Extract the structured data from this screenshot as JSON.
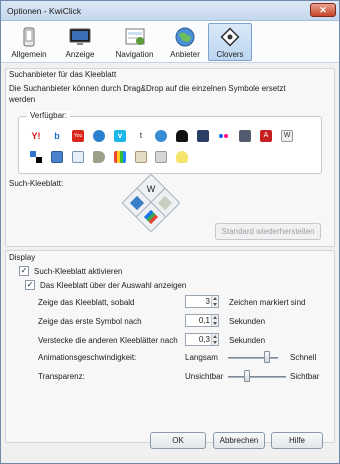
{
  "window": {
    "title": "Optionen - KwiClick",
    "close_label": "✕"
  },
  "toolbar": {
    "tabs": [
      {
        "label": "Allgemein",
        "icon": "device-icon"
      },
      {
        "label": "Anzeige",
        "icon": "monitor-icon"
      },
      {
        "label": "Navigation",
        "icon": "navigation-icon"
      },
      {
        "label": "Anbieter",
        "icon": "globe-icon"
      },
      {
        "label": "Clovers",
        "icon": "clover-icon",
        "active": true
      }
    ]
  },
  "providers": {
    "group_title": "Suchanbieter für das Kleeblatt",
    "description_line1": "Die Suchanbieter können durch Drag&Drop auf die einzelnen Symbole ersetzt",
    "description_line2": "werden",
    "available_label": "Verfügbar:",
    "row1": [
      "yahoo",
      "bing",
      "youtube",
      "amazon",
      "vimeo",
      "twitter",
      "imdb",
      "film",
      "slideshow",
      "flickr",
      "apple",
      "pdf",
      "wikipedia"
    ],
    "row2": [
      "delicious",
      "calendar",
      "ebay",
      "tag",
      "shopping",
      "picture",
      "flag",
      "bulb"
    ],
    "clover_label": "Such-Kleeblatt:",
    "reset_button": "Standard wiederherstellen"
  },
  "display": {
    "group_title": "Display",
    "activate_label": "Such-Kleeblatt aktivieren",
    "activate_checked": true,
    "above_label": "Das Kleeblatt über der Auswahl anzeigen",
    "above_checked": true,
    "show_when_label": "Zeige das Kleeblatt, sobald",
    "show_when_value": "3",
    "show_when_unit": "Zeichen markiert sind",
    "first_symbol_label": "Zeige das erste Symbol nach",
    "first_symbol_value": "0,1",
    "first_symbol_unit": "Sekunden",
    "hide_others_label": "Verstecke die anderen Kleeblätter nach",
    "hide_others_value": "0,3",
    "hide_others_unit": "Sekunden",
    "anim_label": "Animationsgeschwindigkeit:",
    "anim_min": "Langsam",
    "anim_max": "Schnell",
    "anim_level": 0.78,
    "trans_label": "Transparenz:",
    "trans_min": "Unsichtbar",
    "trans_max": "Sichtbar",
    "trans_level": 0.32
  },
  "buttons": {
    "ok": "OK",
    "cancel": "Abbrechen",
    "help": "Hilfe"
  }
}
